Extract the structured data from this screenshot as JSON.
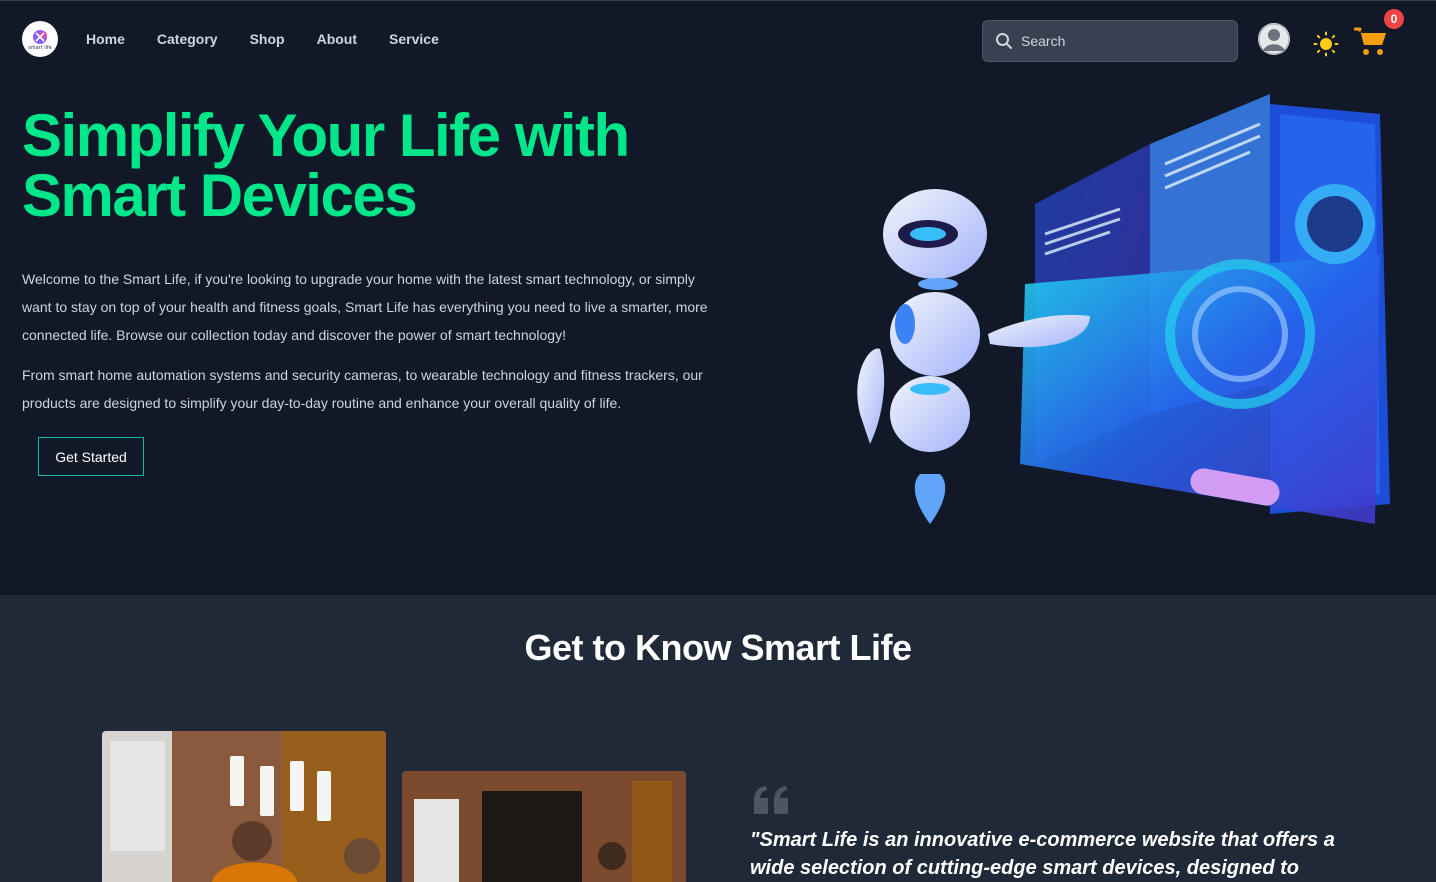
{
  "brand": {
    "logo_text": "smart life"
  },
  "nav": {
    "links": [
      "Home",
      "Category",
      "Shop",
      "About",
      "Service"
    ]
  },
  "search": {
    "placeholder": "Search"
  },
  "cart": {
    "count": "0"
  },
  "hero": {
    "title": "Simplify Your Life with Smart Devices",
    "paragraph1": "Welcome to the Smart Life, if you're looking to upgrade your home with the latest smart technology, or simply want to stay on top of your health and fitness goals, Smart Life has everything you need to live a smarter, more connected life. Browse our collection today and discover the power of smart technology!",
    "paragraph2": "From smart home automation systems and security cameras, to wearable technology and fitness trackers, our products are designed to simplify your day-to-day routine and enhance your overall quality of life.",
    "cta_label": "Get Started"
  },
  "about": {
    "title": "Get to Know Smart Life",
    "quote": "\"Smart Life is an innovative e-commerce website that offers a wide selection of cutting-edge smart devices, designed to"
  },
  "colors": {
    "background": "#111827",
    "section_background": "#1f2937",
    "accent_green": "#00e68a",
    "badge_red": "#ef4444",
    "button_border": "#14b8a6"
  },
  "icons": {
    "logo": "smart-life-logo",
    "search": "search-icon",
    "avatar": "user-avatar-icon",
    "theme": "sun-icon",
    "cart": "cart-icon",
    "quote": "quote-icon"
  }
}
